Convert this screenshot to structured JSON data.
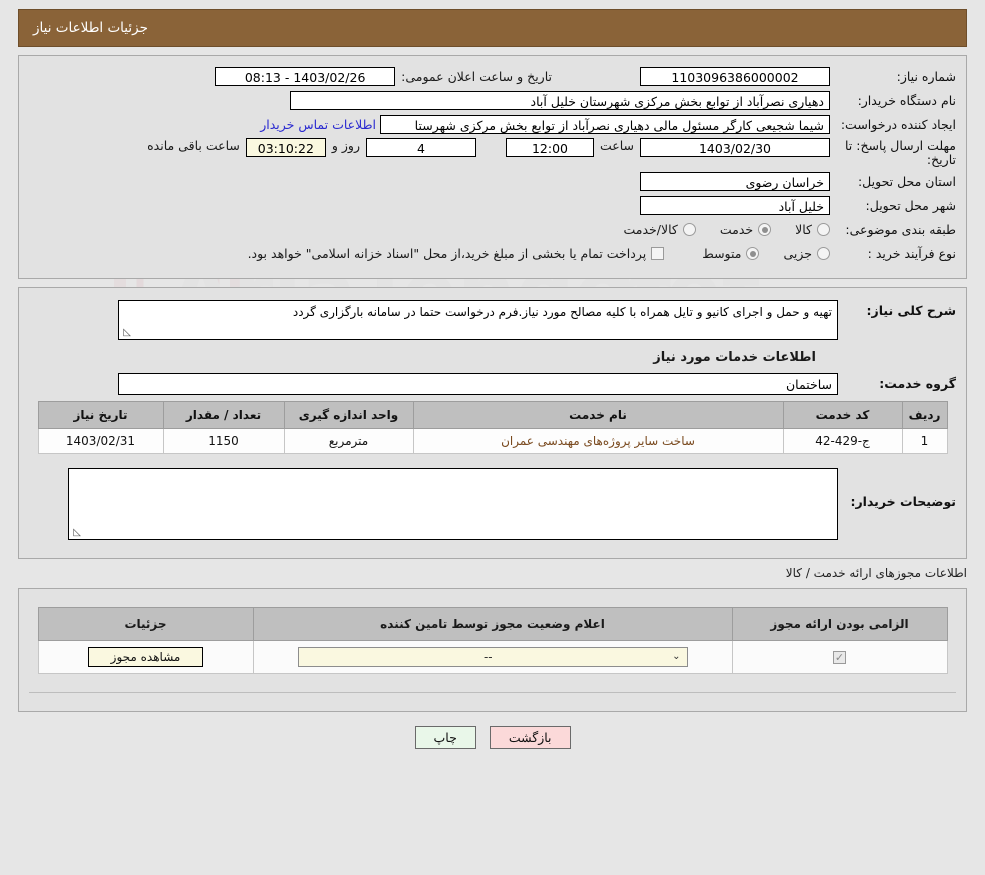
{
  "header": {
    "title": "جزئیات اطلاعات نیاز"
  },
  "info": {
    "need_number_label": "شماره نیاز:",
    "need_number_value": "1103096386000002",
    "announce_datetime_label": "تاریخ و ساعت اعلان عمومی:",
    "announce_datetime_value": "1403/02/26 - 08:13",
    "buyer_org_label": "نام دستگاه خریدار:",
    "buyer_org_value": "دهیاری نصرآباد از توابع بخش مرکزی شهرستان خلیل آباد",
    "creator_label": "ایجاد کننده درخواست:",
    "creator_value": "شیما شجیعی کارگر مسئول مالی دهیاری نصرآباد از توابع بخش مرکزی شهرستا",
    "contact_link": "اطلاعات تماس خریدار",
    "deadline_label": "مهلت ارسال پاسخ: تا تاریخ:",
    "deadline_date": "1403/02/30",
    "hour_label": "ساعت",
    "deadline_time": "12:00",
    "days_value": "4",
    "days_label": "روز و",
    "countdown_value": "03:10:22",
    "countdown_label": "ساعت باقی مانده",
    "province_label": "استان محل تحویل:",
    "province_value": "خراسان رضوی",
    "city_label": "شهر محل تحویل:",
    "city_value": "خلیل آباد",
    "category_label": "طبقه بندی موضوعی:",
    "category_options": [
      {
        "label": "کالا",
        "selected": false
      },
      {
        "label": "خدمت",
        "selected": true
      },
      {
        "label": "کالا/خدمت",
        "selected": false
      }
    ],
    "purchase_type_label": "نوع فرآیند خرید :",
    "purchase_type_options": [
      {
        "label": "جزیی",
        "selected": false
      },
      {
        "label": "متوسط",
        "selected": true
      }
    ],
    "treasury_checkbox_label": "پرداخت تمام یا بخشی از مبلغ خرید،از محل \"اسناد خزانه اسلامی\" خواهد بود.",
    "treasury_checked": false
  },
  "description": {
    "label": "شرح کلی نیاز:",
    "value": "تهیه و حمل و اجرای کانیو و تایل همراه با کلیه مصالح مورد نیاز.فرم درخواست حتما در سامانه بارگزاری گردد",
    "section_title": "اطلاعات خدمات مورد نیاز",
    "service_group_label": "گروه خدمت:",
    "service_group_value": "ساختمان"
  },
  "service_table": {
    "columns": [
      "ردیف",
      "کد خدمت",
      "نام خدمت",
      "واحد اندازه گیری",
      "تعداد / مقدار",
      "تاریخ نیاز"
    ],
    "rows": [
      {
        "row_no": "1",
        "service_code": "ج-429-42",
        "service_name": "ساخت سایر پروژه‌های مهندسی عمران",
        "unit": "مترمربع",
        "quantity": "1150",
        "need_date": "1403/02/31"
      }
    ]
  },
  "buyer_notes": {
    "label": "توضیحات خریدار:",
    "value": ""
  },
  "permits": {
    "section_title": "اطلاعات مجوزهای ارائه خدمت / کالا",
    "columns": [
      "الزامی بودن ارائه مجوز",
      "اعلام وضعیت مجوز توسط تامین کننده",
      "جزئیات"
    ],
    "rows": [
      {
        "required_checked": true,
        "status_value": "--",
        "details_button": "مشاهده مجوز"
      }
    ]
  },
  "footer": {
    "print_label": "چاپ",
    "back_label": "بازگشت"
  },
  "icons": {
    "resize_grip": "◺",
    "chevron_down": "⌄",
    "check": "✓"
  },
  "colors": {
    "header_bar": "#8a6338",
    "page_bg": "#e6e6e6",
    "panel_bg": "#e2e2e2",
    "link": "#2a2ad0",
    "table_header": "#bfbfbf",
    "field_yellow": "#faf8e0",
    "print_button": "#e9f7e9",
    "back_button": "#fbd9d9"
  },
  "watermark": {
    "text": "AriaTender.net"
  }
}
